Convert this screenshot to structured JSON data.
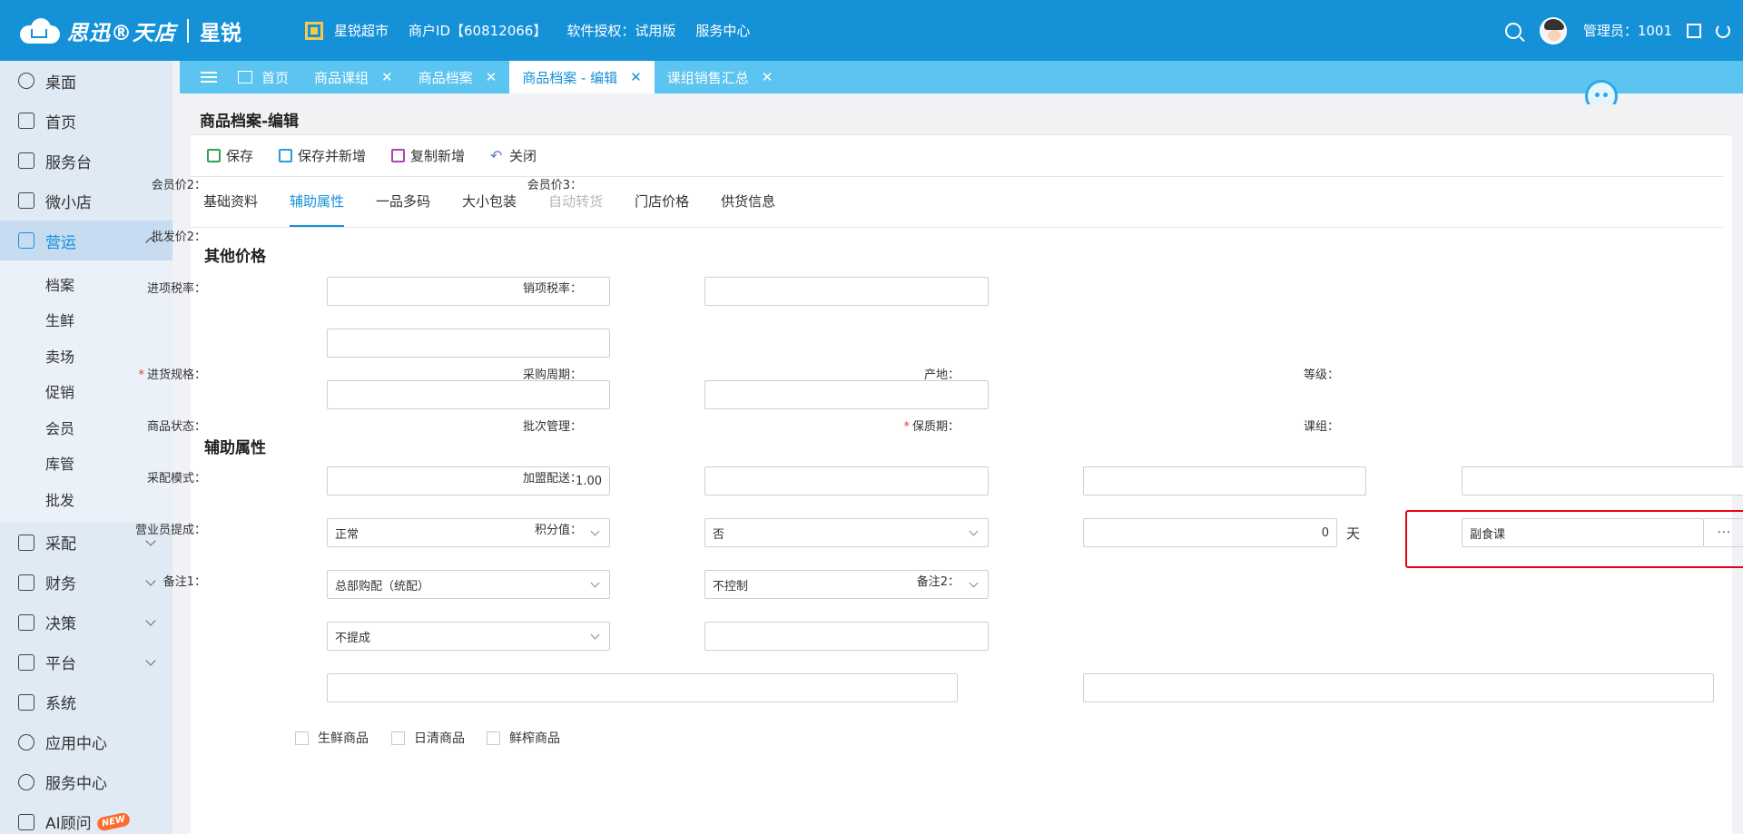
{
  "header": {
    "logo_text": "思迅®天店",
    "brand": "星锐",
    "menu": [
      "星锐超市",
      "商户ID【60812066】",
      "软件授权：试用版",
      "服务中心"
    ],
    "user": "管理员：1001"
  },
  "sidebar": {
    "items": [
      {
        "label": "桌面",
        "icon": "desktop-icon"
      },
      {
        "label": "首页",
        "icon": "home-icon"
      },
      {
        "label": "服务台",
        "icon": "service-desk-icon"
      },
      {
        "label": "微小店",
        "icon": "shop-icon"
      },
      {
        "label": "营运",
        "icon": "operations-icon"
      },
      {
        "label": "采配",
        "icon": "cart-icon"
      },
      {
        "label": "财务",
        "icon": "finance-icon"
      },
      {
        "label": "决策",
        "icon": "decision-icon"
      },
      {
        "label": "平台",
        "icon": "platform-icon"
      },
      {
        "label": "系统",
        "icon": "system-icon"
      },
      {
        "label": "应用中心",
        "icon": "apps-icon"
      },
      {
        "label": "服务中心",
        "icon": "service-center-icon"
      },
      {
        "label": "AI顾问",
        "icon": "ai-icon",
        "badge": "NEW"
      }
    ],
    "subitems": [
      "档案",
      "生鲜",
      "卖场",
      "促销",
      "会员",
      "库管",
      "批发"
    ]
  },
  "tabs": [
    {
      "label": "首页"
    },
    {
      "label": "商品课组"
    },
    {
      "label": "商品档案"
    },
    {
      "label": "商品档案 - 编辑"
    },
    {
      "label": "课组销售汇总"
    }
  ],
  "page": {
    "title": "商品档案-编辑",
    "toolbar": {
      "save": "保存",
      "save_new": "保存并新增",
      "copy_new": "复制新增",
      "close": "关闭"
    },
    "subtabs": [
      "基础资料",
      "辅助属性",
      "一品多码",
      "大小包装",
      "自动转货",
      "门店价格",
      "供货信息"
    ]
  },
  "other_prices": {
    "title": "其他价格",
    "member_price2": {
      "label": "会员价2：",
      "value": ""
    },
    "member_price3": {
      "label": "会员价3：",
      "value": ""
    },
    "wholesale_price2": {
      "label": "批发价2：",
      "value": ""
    },
    "input_tax": {
      "label": "进项税率：",
      "value": ""
    },
    "output_tax": {
      "label": "销项税率：",
      "value": ""
    }
  },
  "aux": {
    "title": "辅助属性",
    "purchase_spec": {
      "label": "进货规格：",
      "value": "1.00"
    },
    "purchase_cycle": {
      "label": "采购周期：",
      "value": ""
    },
    "origin": {
      "label": "产地：",
      "value": ""
    },
    "grade": {
      "label": "等级：",
      "value": ""
    },
    "status": {
      "label": "商品状态：",
      "value": "正常"
    },
    "batch": {
      "label": "批次管理：",
      "value": "否"
    },
    "shelf_life": {
      "label": "保质期：",
      "value": "0",
      "unit": "天"
    },
    "group": {
      "label": "课组：",
      "value": "副食课",
      "button": "···"
    },
    "purchase_mode": {
      "label": "采配模式：",
      "value": "总部购配（统配）"
    },
    "franchise": {
      "label": "加盟配送：",
      "value": "不控制"
    },
    "commission": {
      "label": "营业员提成：",
      "value": "不提成"
    },
    "points": {
      "label": "积分值：",
      "value": ""
    },
    "note1": {
      "label": "备注1：",
      "value": ""
    },
    "note2": {
      "label": "备注2：",
      "value": ""
    },
    "checkboxes": [
      "生鲜商品",
      "日清商品",
      "鲜榨商品"
    ]
  }
}
